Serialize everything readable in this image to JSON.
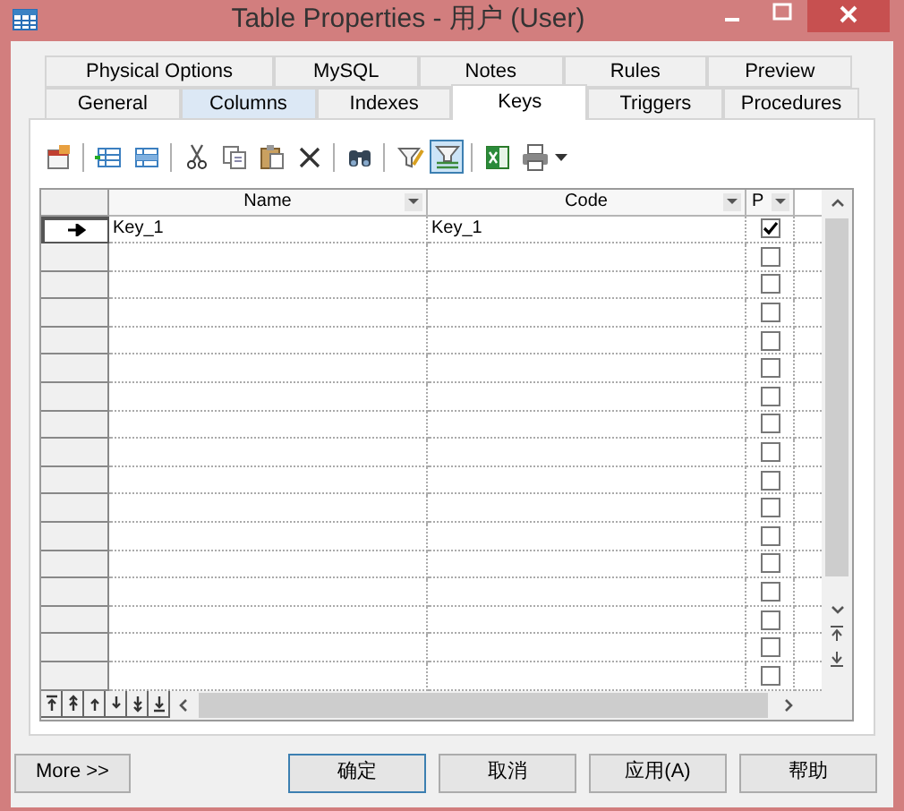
{
  "window": {
    "title": "Table Properties - 用户 (User)"
  },
  "tab_rows": [
    [
      {
        "label": "Physical Options",
        "selected": false,
        "hovered": false
      },
      {
        "label": "MySQL",
        "selected": false,
        "hovered": false
      },
      {
        "label": "Notes",
        "selected": false,
        "hovered": false
      },
      {
        "label": "Rules",
        "selected": false,
        "hovered": false
      },
      {
        "label": "Preview",
        "selected": false,
        "hovered": false
      }
    ],
    [
      {
        "label": "General",
        "selected": false,
        "hovered": false
      },
      {
        "label": "Columns",
        "selected": false,
        "hovered": true
      },
      {
        "label": "Indexes",
        "selected": false,
        "hovered": false
      },
      {
        "label": "Keys",
        "selected": true,
        "hovered": false
      },
      {
        "label": "Triggers",
        "selected": false,
        "hovered": false
      },
      {
        "label": "Procedures",
        "selected": false,
        "hovered": false
      }
    ]
  ],
  "toolbar": [
    {
      "kind": "properties",
      "pressed": false
    },
    {
      "kind": "sep"
    },
    {
      "kind": "add-row",
      "pressed": false
    },
    {
      "kind": "insert-row",
      "pressed": false
    },
    {
      "kind": "sep"
    },
    {
      "kind": "cut",
      "pressed": false
    },
    {
      "kind": "copy",
      "pressed": false
    },
    {
      "kind": "paste",
      "pressed": false
    },
    {
      "kind": "delete",
      "pressed": false
    },
    {
      "kind": "sep"
    },
    {
      "kind": "find",
      "pressed": false
    },
    {
      "kind": "sep"
    },
    {
      "kind": "filter",
      "pressed": false
    },
    {
      "kind": "filter-toggle",
      "pressed": true
    },
    {
      "kind": "sep"
    },
    {
      "kind": "excel",
      "pressed": false
    },
    {
      "kind": "print",
      "pressed": false
    }
  ],
  "grid": {
    "columns": [
      {
        "label": "Name"
      },
      {
        "label": "Code"
      },
      {
        "label": "P"
      }
    ],
    "rows": [
      {
        "current": true,
        "name": "Key_1",
        "code": "Key_1",
        "primary": true
      },
      {
        "current": false,
        "primary": false
      },
      {
        "current": false,
        "primary": false
      },
      {
        "current": false,
        "primary": false
      },
      {
        "current": false,
        "primary": false
      },
      {
        "current": false,
        "primary": false
      },
      {
        "current": false,
        "primary": false
      },
      {
        "current": false,
        "primary": false
      },
      {
        "current": false,
        "primary": false
      },
      {
        "current": false,
        "primary": false
      },
      {
        "current": false,
        "primary": false
      },
      {
        "current": false,
        "primary": false
      },
      {
        "current": false,
        "primary": false
      },
      {
        "current": false,
        "primary": false
      },
      {
        "current": false,
        "primary": false
      },
      {
        "current": false,
        "primary": false
      },
      {
        "current": false,
        "primary": false
      }
    ]
  },
  "buttons": [
    {
      "label": "More >>",
      "default": false
    },
    {
      "label": "确定",
      "default": true
    },
    {
      "label": "取消",
      "default": false
    },
    {
      "label": "应用(A)",
      "default": false
    },
    {
      "label": "帮助",
      "default": false
    }
  ]
}
